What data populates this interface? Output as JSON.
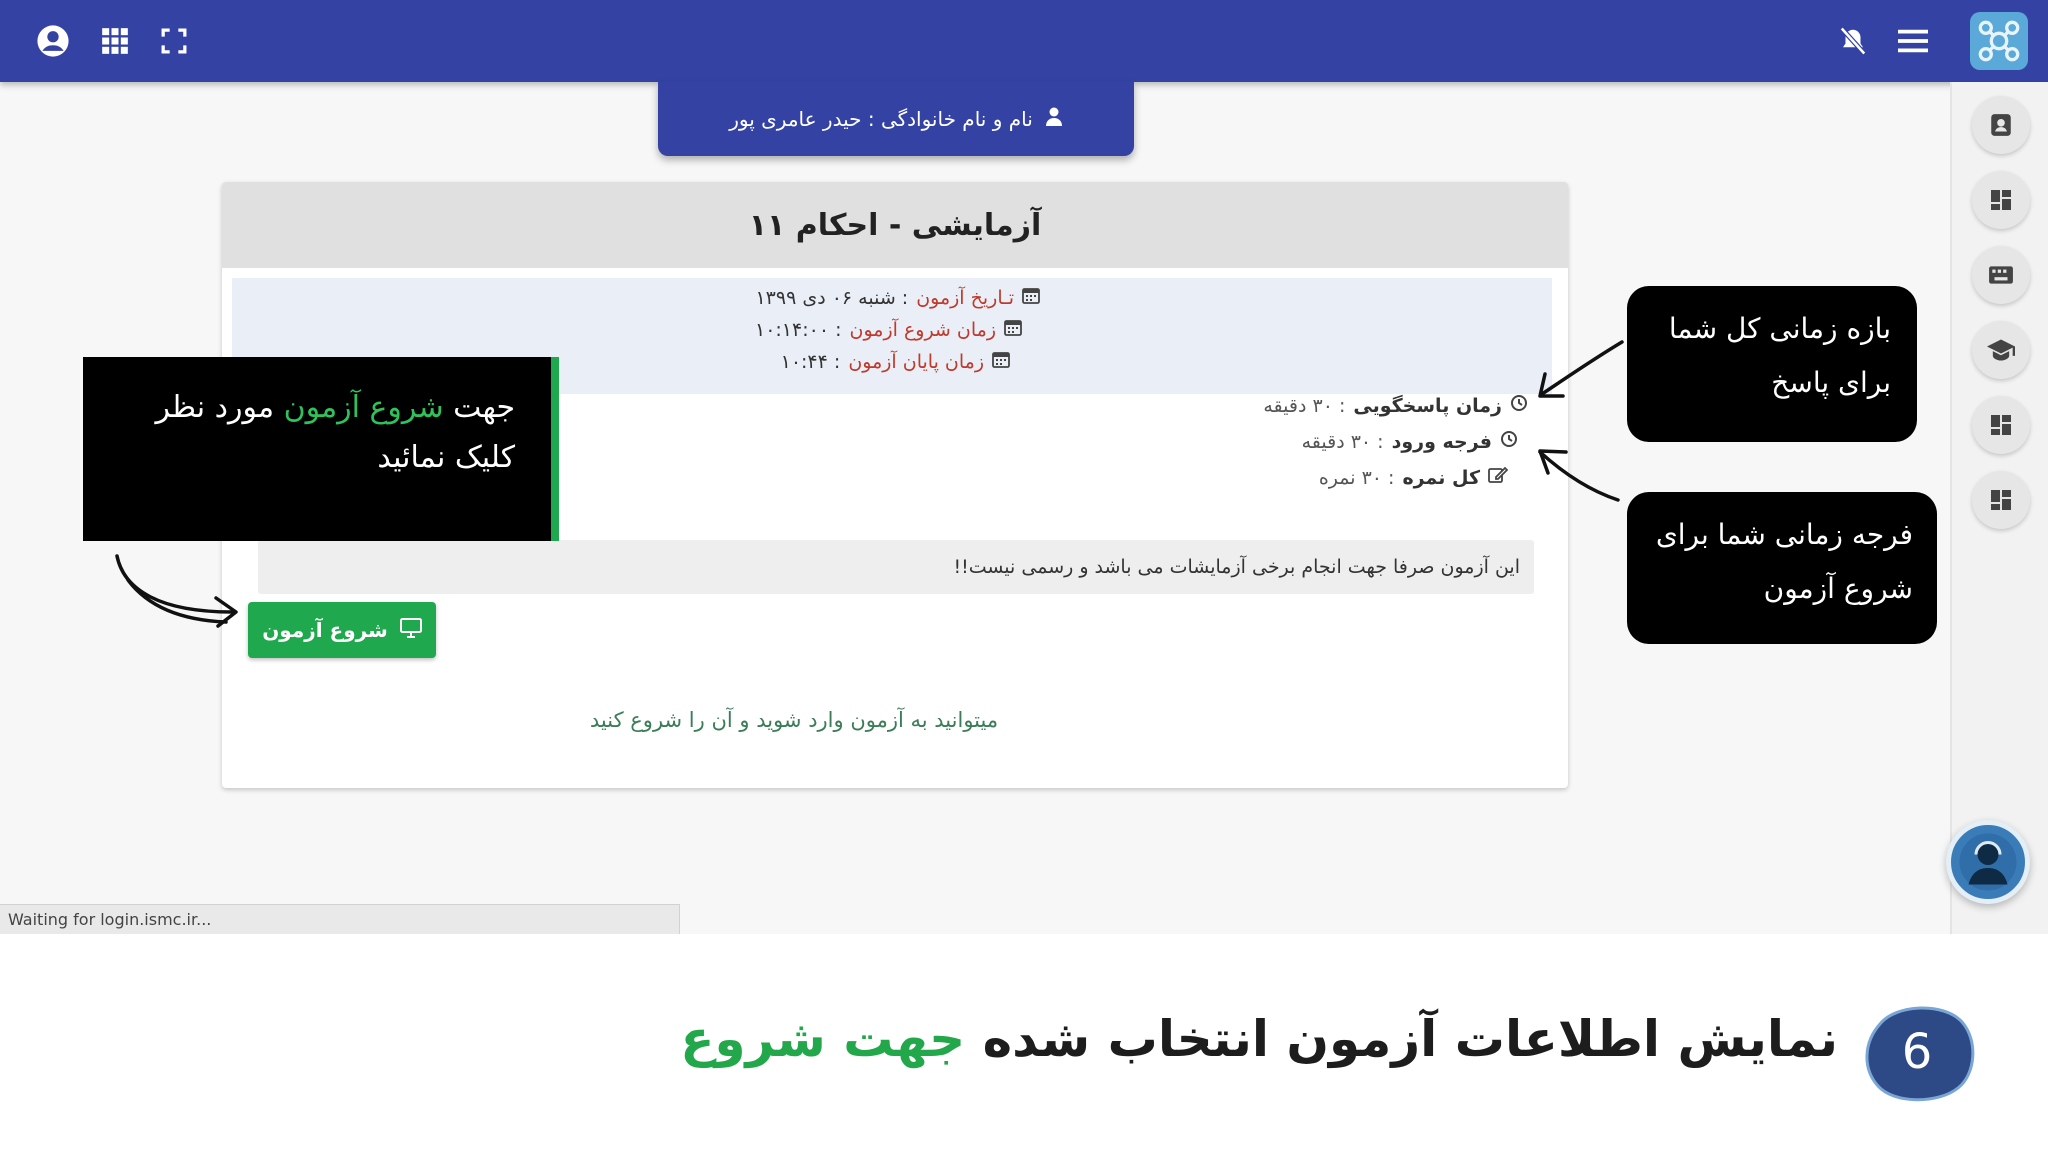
{
  "topbar": {
    "left_icons": [
      "account-circle-icon",
      "apps-grid-icon",
      "fullscreen-icon"
    ],
    "right_icons": [
      "notifications-off-icon",
      "menu-icon"
    ],
    "logo": "organization-logo"
  },
  "user": {
    "label": "نام و نام خانوادگی : حیدر عامری پور"
  },
  "exam": {
    "title": "آزمایشی - احکام ۱۱",
    "date_label": "تـاریخ آزمون",
    "date_value": ": شنبه ۰۶ دی ۱۳۹۹",
    "start_label": "زمان شروع آزمون",
    "start_value": ": ۱۰:۱۴:۰۰",
    "end_label": "زمان پایان آزمون",
    "end_value": ": ۱۰:۴۴",
    "answer_time_label": "زمان پاسخگویی",
    "answer_time_value": ": ۳۰ دقیقه",
    "entry_window_label": "فرجه ورود",
    "entry_window_value": ": ۳۰ دقیقه",
    "total_score_label": "کل نمره",
    "total_score_value": ": ۳۰ نمره",
    "notice": "این آزمون صرفا جهت انجام برخی آزمایشات می باشد و رسمی نیست!!",
    "start_button": "شروع آزمون",
    "enter_note": "میتوانید به آزمون وارد شوید و آن را شروع کنید"
  },
  "status_bar": {
    "text": "Waiting for login.ismc.ir..."
  },
  "tutorial": {
    "left_callout_pre": "جهت",
    "left_callout_highlight": "شروع آزمون",
    "left_callout_post": "مورد نظر",
    "left_callout_line2": "کلیک نمائید",
    "callout_1_line1": "بازه زمانی کل شما",
    "callout_1_line2": "برای پاسخ",
    "callout_2_line1": "فرجه زمانی شما برای",
    "callout_2_line2": "شروع آزمون",
    "step_number": "6",
    "caption_main": "نمایش اطلاعات آزمون انتخاب شده",
    "caption_highlight": "جهت شروع"
  },
  "colors": {
    "topbar": "#3443a3",
    "accent_green": "#1fa84d",
    "label_red": "#c0392b",
    "step_badge": "#2d4a86"
  }
}
